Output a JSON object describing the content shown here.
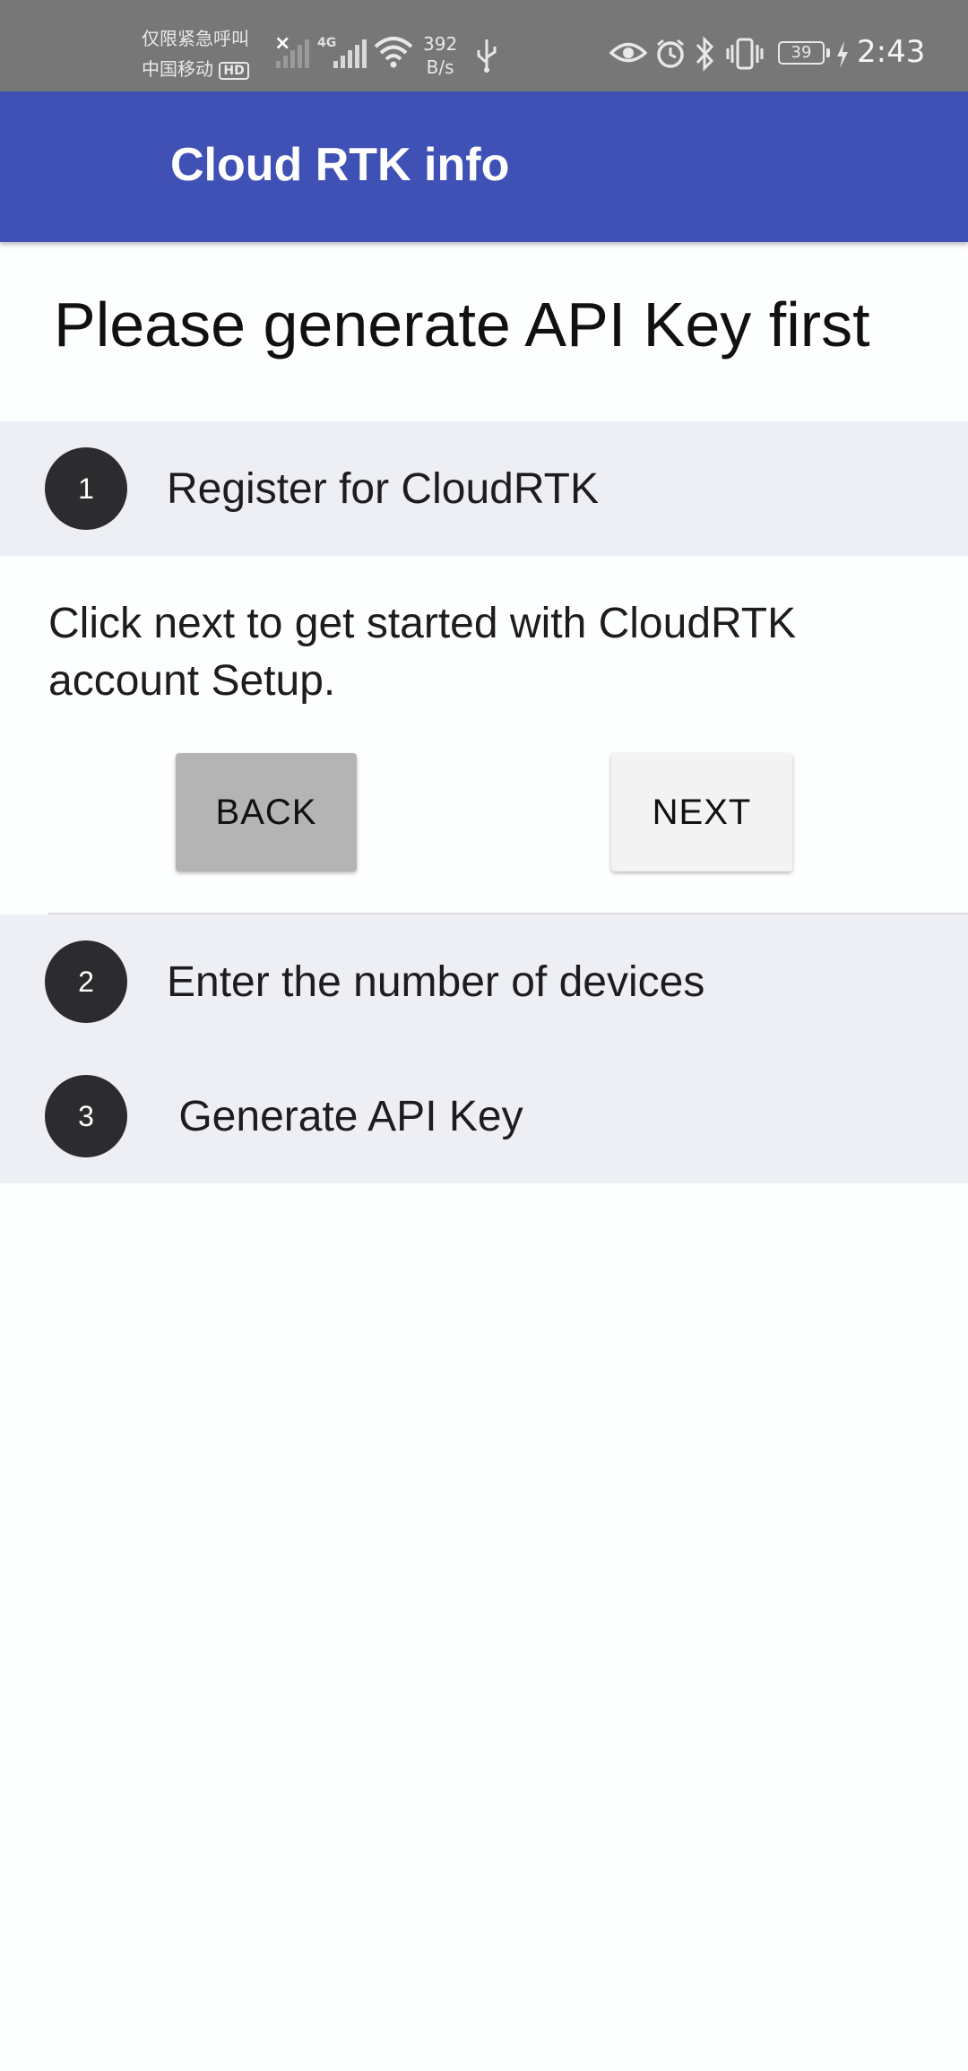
{
  "status_bar": {
    "carrier_line1": "仅限紧急呼叫",
    "carrier_line2": "中国移动",
    "hd_badge": "HD",
    "network_type": "4G",
    "speed_value": "392",
    "speed_unit": "B/s",
    "battery_level": "39",
    "time": "2:43"
  },
  "app_bar": {
    "title": "Cloud RTK info"
  },
  "page": {
    "heading": "Please generate API Key first"
  },
  "stepper": {
    "steps": [
      {
        "number": "1",
        "label": "Register for CloudRTK",
        "active": true
      },
      {
        "number": "2",
        "label": "Enter the number of devices",
        "active": false
      },
      {
        "number": "3",
        "label": " Generate API Key",
        "active": false
      }
    ],
    "active_content": {
      "text": "Click next to get started with CloudRTK account Setup.",
      "back_label": "BACK",
      "next_label": "NEXT"
    }
  },
  "colors": {
    "app_bar": "#3f51b5",
    "status_bar": "#777777",
    "step_header_bg": "#eeeff4",
    "step_circle": "#2c2c2e",
    "back_button": "#b4b4b4",
    "next_button": "#f3f3f3"
  }
}
